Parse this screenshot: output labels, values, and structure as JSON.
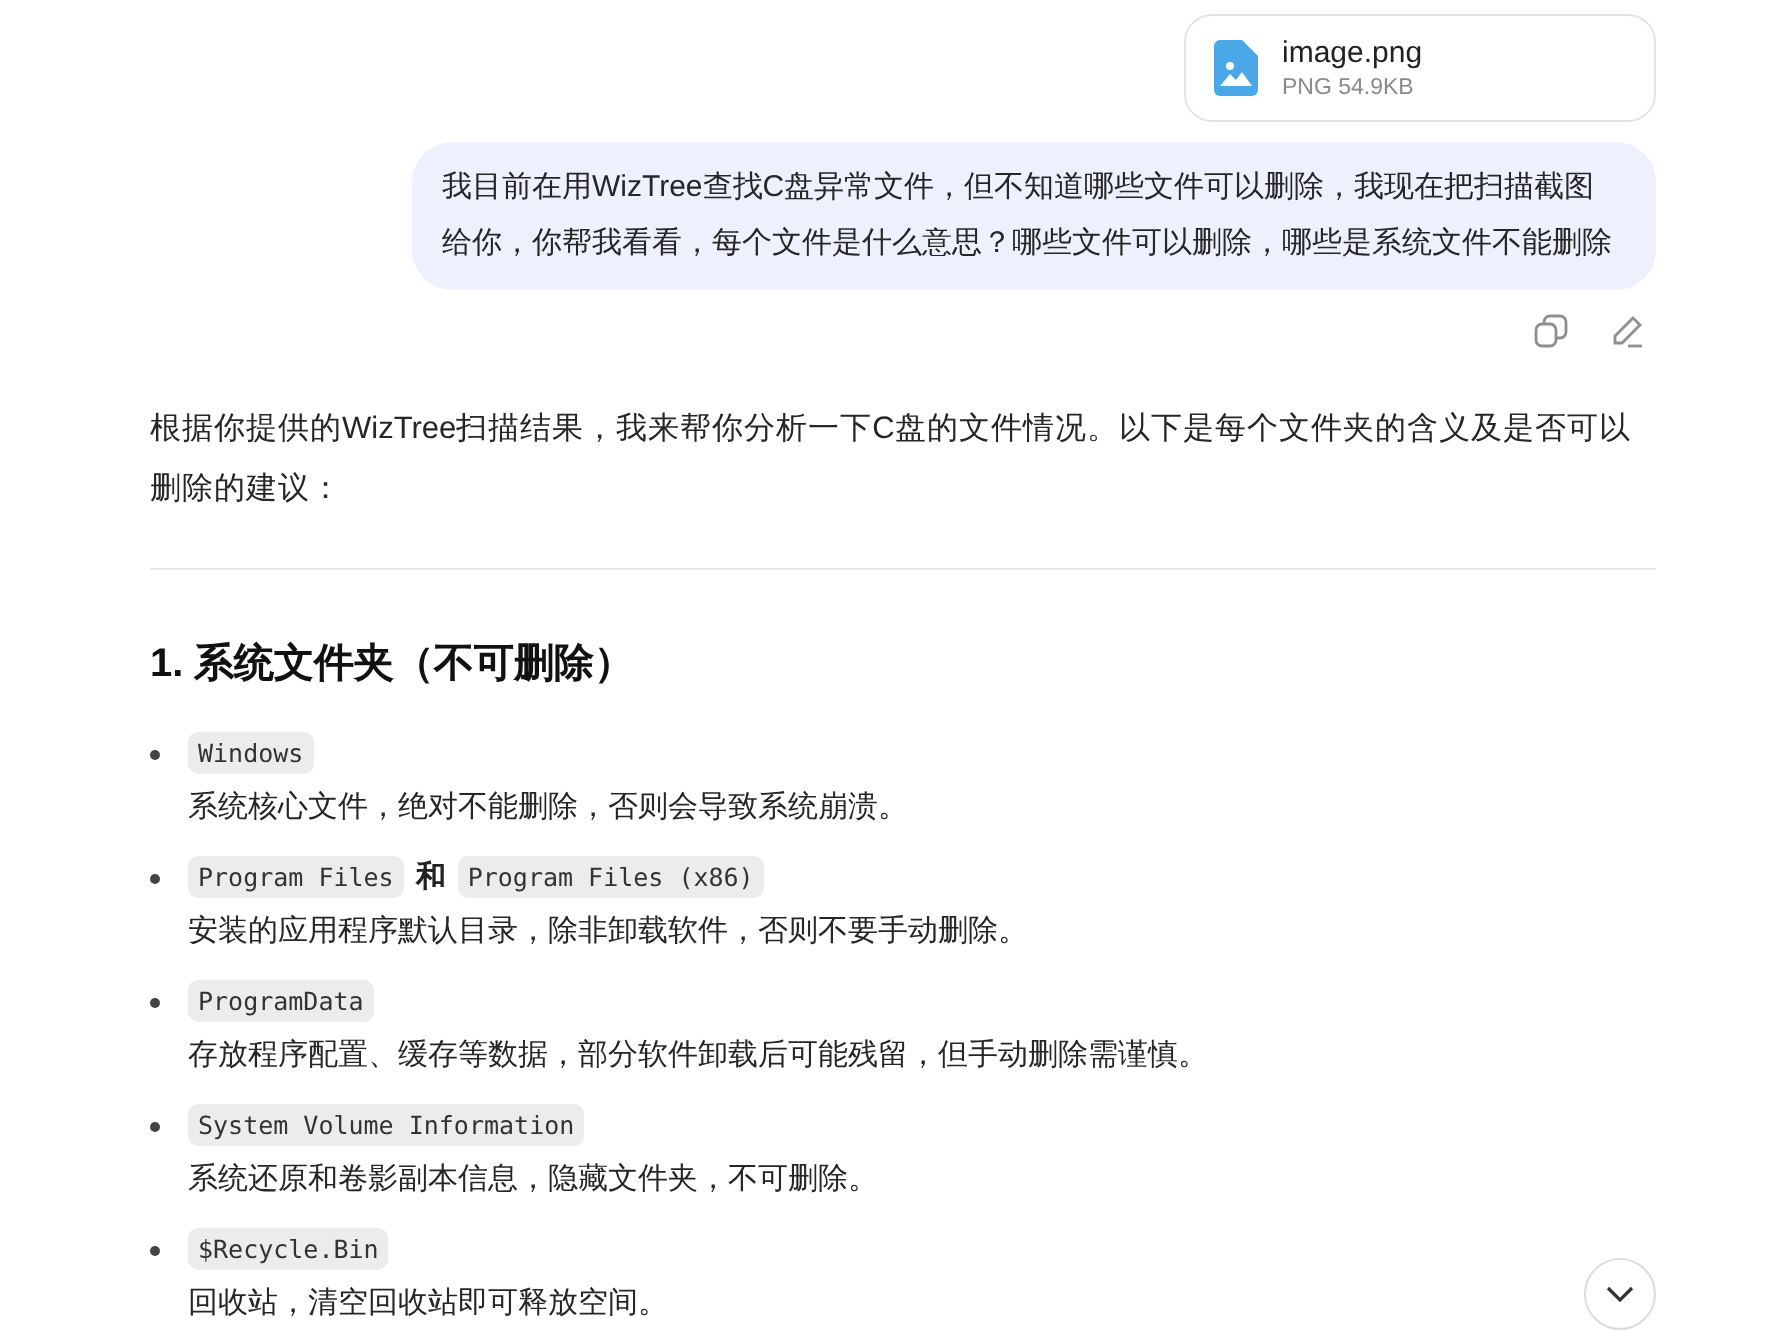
{
  "attachment": {
    "name": "image.png",
    "meta": "PNG 54.9KB"
  },
  "user_message": {
    "lines": [
      "我目前在用WizTree查找C盘异常文件，但不知道哪些文件可以删除，我现在把扫描截图",
      "给你，你帮我看看，每个文件是什么意思？哪些文件可以删除，哪些是系统文件不能删除"
    ]
  },
  "reply": {
    "intro": "根据你提供的WizTree扫描结果，我来帮你分析一下C盘的文件情况。以下是每个文件夹的含义及是否可以删除的建议：",
    "heading": "1. 系统文件夹（不可删除）",
    "items": [
      {
        "title": [
          {
            "kind": "code",
            "text": "Windows"
          }
        ],
        "description": "系统核心文件，绝对不能删除，否则会导致系统崩溃。"
      },
      {
        "title": [
          {
            "kind": "code",
            "text": "Program Files"
          },
          {
            "kind": "text",
            "text": "和"
          },
          {
            "kind": "code",
            "text": "Program Files (x86)"
          }
        ],
        "description": "安装的应用程序默认目录，除非卸载软件，否则不要手动删除。"
      },
      {
        "title": [
          {
            "kind": "code",
            "text": "ProgramData"
          }
        ],
        "description": "存放程序配置、缓存等数据，部分软件卸载后可能残留，但手动删除需谨慎。"
      },
      {
        "title": [
          {
            "kind": "code",
            "text": "System Volume Information"
          }
        ],
        "description": "系统还原和卷影副本信息，隐藏文件夹，不可删除。"
      },
      {
        "title": [
          {
            "kind": "code",
            "text": "$Recycle.Bin"
          }
        ],
        "description": "回收站，清空回收站即可释放空间。"
      }
    ]
  }
}
